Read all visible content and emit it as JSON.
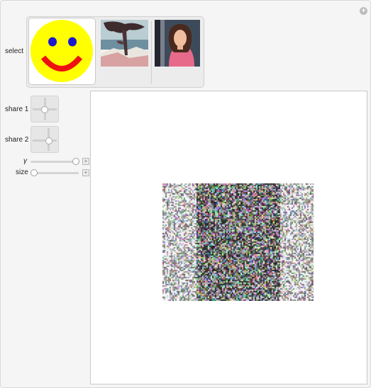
{
  "controls": {
    "select_label": "select",
    "share1_label": "share 1",
    "share2_label": "share 2",
    "gamma_label": "γ",
    "size_label": "size",
    "gamma_value": 0.94,
    "size_value": 0.0
  },
  "image_options": [
    {
      "name": "smiley",
      "selected": true
    },
    {
      "name": "tree-photo",
      "selected": false
    },
    {
      "name": "portrait-photo",
      "selected": false
    }
  ],
  "colors": {
    "smiley_face": "#ffff00",
    "smiley_eyes": "#1a1acc",
    "smiley_mouth": "#ee1111"
  }
}
